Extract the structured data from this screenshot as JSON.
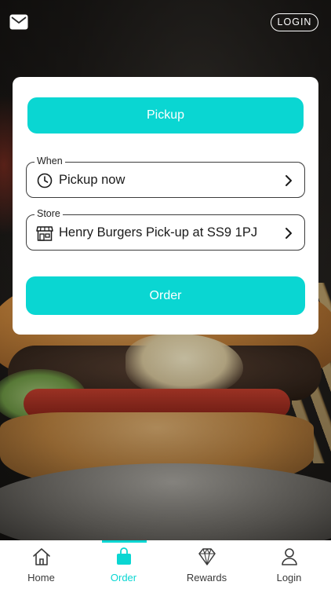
{
  "header": {
    "mail_icon": "mail-icon",
    "login_label": "LOGIN"
  },
  "card": {
    "pickup_label": "Pickup",
    "when": {
      "legend": "When",
      "value": "Pickup now",
      "icon": "clock-icon"
    },
    "store": {
      "legend": "Store",
      "value": "Henry Burgers Pick-up at SS9 1PJ",
      "icon": "store-icon"
    },
    "order_label": "Order"
  },
  "tabbar": {
    "active": "Order",
    "tabs": [
      {
        "label": "Home",
        "icon": "home-icon"
      },
      {
        "label": "Order",
        "icon": "bag-icon"
      },
      {
        "label": "Rewards",
        "icon": "diamond-icon"
      },
      {
        "label": "Login",
        "icon": "user-icon"
      }
    ]
  },
  "colors": {
    "accent": "#0ad6d2",
    "card_bg": "#ffffff",
    "text": "#1a1a1a"
  }
}
